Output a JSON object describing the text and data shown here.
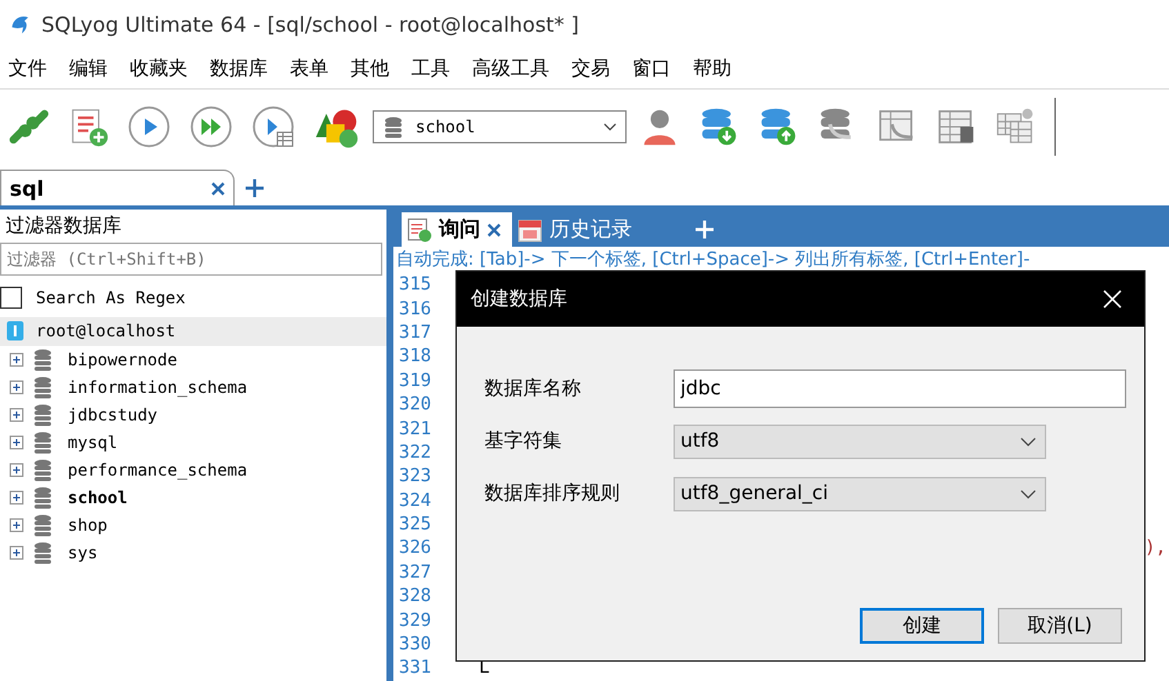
{
  "window": {
    "title": "SQLyog Ultimate 64 - [sql/school - root@localhost* ]"
  },
  "menu": [
    "文件",
    "编辑",
    "收藏夹",
    "数据库",
    "表单",
    "其他",
    "工具",
    "高级工具",
    "交易",
    "窗口",
    "帮助"
  ],
  "toolbar": {
    "database_selector": {
      "value": "school"
    }
  },
  "connection_tabs": [
    {
      "label": "sql",
      "selected": true
    }
  ],
  "sidebar": {
    "title": "过滤器数据库",
    "filter": {
      "placeholder": "过滤器 (Ctrl+Shift+B)"
    },
    "regex": {
      "label": "Search As Regex",
      "checked": false
    },
    "tree": {
      "label": "root@localhost",
      "selected": true,
      "expanded": true,
      "children": [
        {
          "label": "bipowernode",
          "current": false
        },
        {
          "label": "information_schema",
          "current": false
        },
        {
          "label": "jdbcstudy",
          "current": false
        },
        {
          "label": "mysql",
          "current": false
        },
        {
          "label": "performance_schema",
          "current": false
        },
        {
          "label": "school",
          "current": true
        },
        {
          "label": "shop",
          "current": false
        },
        {
          "label": "sys",
          "current": false
        }
      ]
    }
  },
  "editor": {
    "tabs": [
      {
        "label": "询问",
        "selected": true,
        "kind": "query"
      },
      {
        "label": "历史记录",
        "selected": false,
        "kind": "history"
      }
    ],
    "hint": "自动完成: [Tab]-> 下一个标签, [Ctrl+Space]-> 列出所有标签, [Ctrl+Enter]-",
    "lines": [
      {
        "number": "315"
      },
      {
        "number": "316"
      },
      {
        "number": "317"
      },
      {
        "number": "318"
      },
      {
        "number": "319"
      },
      {
        "number": "320"
      },
      {
        "number": "321"
      },
      {
        "number": "322"
      },
      {
        "number": "323"
      },
      {
        "number": "324"
      },
      {
        "number": "325"
      },
      {
        "number": "326",
        "text": "),",
        "kind": "tail"
      },
      {
        "number": "327"
      },
      {
        "number": "328"
      },
      {
        "number": "329"
      },
      {
        "number": "330"
      },
      {
        "number": "331",
        "text": "L",
        "kind": "plain"
      }
    ]
  },
  "dialog": {
    "title": "创建数据库",
    "fields": [
      {
        "kind": "text",
        "label": "数据库名称",
        "value": "jdbc"
      },
      {
        "kind": "select",
        "label": "基字符集",
        "value": "utf8"
      },
      {
        "kind": "select",
        "label": "数据库排序规则",
        "value": "utf8_general_ci"
      }
    ],
    "buttons": [
      {
        "label": "创建",
        "default": true
      },
      {
        "label": "取消(L)",
        "default": false
      }
    ]
  }
}
